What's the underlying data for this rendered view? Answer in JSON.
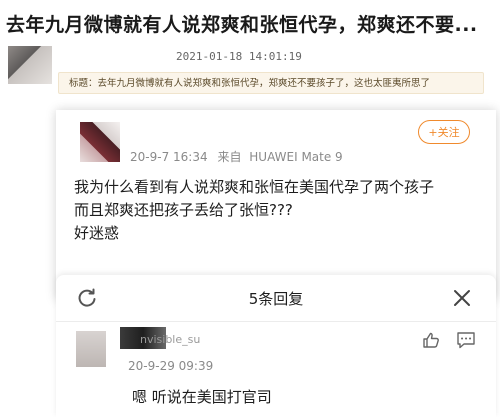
{
  "article": {
    "headline": "去年九月微博就有人说郑爽和张恒代孕，郑爽还不要...",
    "timestamp": "2021-01-18 14:01:19",
    "topic": "标题：去年九月微博就有人说郑爽和张恒代孕，郑爽还不要孩子了，这也太匪夷所思了"
  },
  "comment": {
    "follow_label": "+关注",
    "date": "20-9-7 16:34",
    "via_label": "来自",
    "device": "HUAWEI Mate 9",
    "lines": [
      "我为什么看到有人说郑爽和张恒在美国代孕了两个孩子",
      "而且郑爽还把孩子丢给了张恒???",
      "好迷惑"
    ]
  },
  "replies_panel": {
    "title": "5条回复",
    "reply": {
      "username_fragment": "nvisible_su",
      "time": "20-9-29 09:39",
      "text": "嗯 听说在美国打官司"
    }
  },
  "colors": {
    "accent": "#f08a2d",
    "topic_bg": "#fbf5ea",
    "muted": "#8a8a8a"
  }
}
